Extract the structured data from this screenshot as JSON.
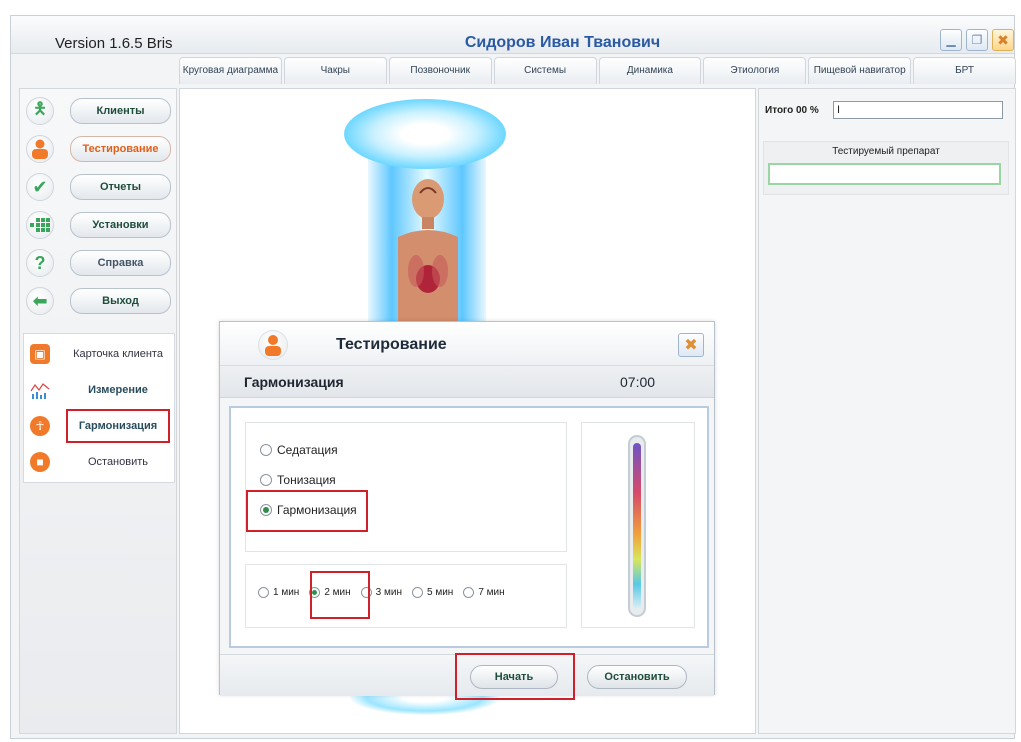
{
  "window": {
    "version": "Version  1.6.5  Bris",
    "title": "Сидоров  Иван  Тванович",
    "minimize_icon": "minimize-icon",
    "maximize_icon": "maximize-icon",
    "close_icon": "close-icon"
  },
  "tabs": [
    {
      "label": "Круговая диаграмма"
    },
    {
      "label": "Чакры"
    },
    {
      "label": "Позвоночник"
    },
    {
      "label": "Системы"
    },
    {
      "label": "Динамика"
    },
    {
      "label": "Этиология"
    },
    {
      "label": "Пищевой навигатор"
    },
    {
      "label": "БРТ"
    }
  ],
  "sidebar": {
    "menu": [
      {
        "label": "Клиенты",
        "icon": "person-icon"
      },
      {
        "label": "Тестирование",
        "icon": "user-icon"
      },
      {
        "label": "Отчеты",
        "icon": "checkmark-icon"
      },
      {
        "label": "Установки",
        "icon": "grid-icon"
      },
      {
        "label": "Справка",
        "icon": "question-icon"
      },
      {
        "label": "Выход",
        "icon": "exit-arrow-icon"
      }
    ],
    "sub": [
      {
        "label": "Карточка клиента",
        "icon": "client-card-icon"
      },
      {
        "label": "Измерение",
        "icon": "measurement-chart-icon"
      },
      {
        "label": "Гармонизация",
        "icon": "harmonization-icon"
      },
      {
        "label": "Остановить",
        "icon": "stop-icon"
      }
    ]
  },
  "right_panel": {
    "total_label": "Итого  00 %",
    "total_value": "I",
    "drug_title": "Тестируемый препарат",
    "drug_value": ""
  },
  "dialog": {
    "title": "Тестирование",
    "subtitle": "Гармонизация",
    "time": "07:00",
    "modes": [
      {
        "label": "Седатация",
        "checked": false
      },
      {
        "label": "Тонизация",
        "checked": false
      },
      {
        "label": "Гармонизация",
        "checked": true
      }
    ],
    "durations": [
      {
        "label": "1 мин",
        "checked": false
      },
      {
        "label": "2 мин",
        "checked": true
      },
      {
        "label": "3 мин",
        "checked": false
      },
      {
        "label": "5 мин",
        "checked": false
      },
      {
        "label": "7 мин",
        "checked": false
      }
    ],
    "start_label": "Начать",
    "stop_label": "Остановить"
  },
  "colors": {
    "title_blue": "#2b5aa3",
    "accent_orange": "#e0601b",
    "highlight_red": "#d0212b",
    "green_text": "#1e4d3a"
  }
}
